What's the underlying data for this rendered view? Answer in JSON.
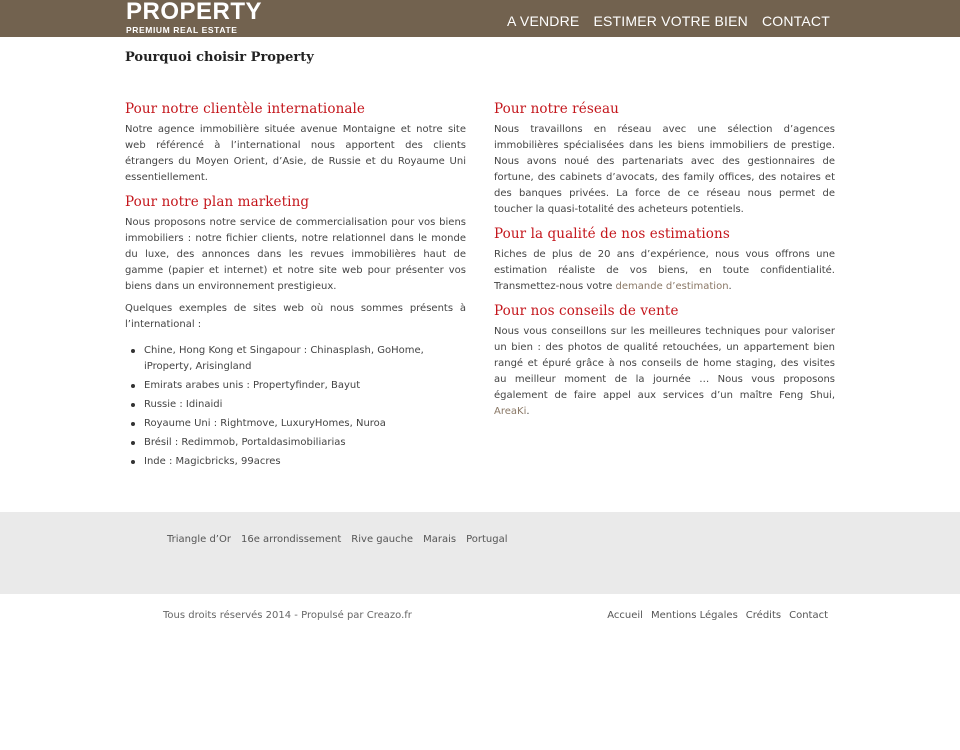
{
  "header": {
    "logo_title": "PROPERTY",
    "logo_subtitle": "PREMIUM REAL ESTATE",
    "nav": [
      "A VENDRE",
      "ESTIMER VOTRE BIEN",
      "CONTACT"
    ],
    "bg_color": "#72624f"
  },
  "page": {
    "title": "Pourquoi choisir Property"
  },
  "left": {
    "international": {
      "heading": "Pour notre clientèle internationale",
      "text": "Notre agence immobilière située avenue Montaigne et notre site web référencé à l’international nous apportent des clients étrangers du Moyen Orient, d’Asie, de Russie et du Royaume Uni essentiellement."
    },
    "marketing": {
      "heading": "Pour notre plan marketing",
      "text1": "Nous proposons notre service de commercialisation pour vos biens immobiliers : notre fichier clients, notre relationnel dans le monde du luxe, des annonces dans les revues immobilières haut de gamme (papier et internet) et notre site web pour présenter vos biens dans un environnement prestigieux.",
      "text2": "Quelques exemples de sites web où nous sommes présents à l’international :",
      "examples": [
        "Chine, Hong Kong et Singapour : Chinasplash, GoHome, iProperty, Arisingland",
        "Emirats arabes unis : Propertyfinder, Bayut",
        "Russie : Idinaidi",
        "Royaume Uni : Rightmove, LuxuryHomes, Nuroa",
        "Brésil : Redimmob, Portaldasimobiliarias",
        "Inde : Magicbricks, 99acres"
      ]
    }
  },
  "right": {
    "reseau": {
      "heading": "Pour notre réseau",
      "text": "Nous travaillons en réseau avec une sélection d’agences immobilières spécialisées dans les biens immobiliers de prestige. Nous avons noué des partenariats avec des gestionnaires de fortune, des cabinets d’avocats, des family offices, des notaires et des banques privées. La force de ce réseau nous permet de toucher la quasi-totalité des acheteurs potentiels."
    },
    "estimations": {
      "heading": "Pour la qualité de nos estimations",
      "text": "Riches de plus de 20 ans d’expérience, nous vous offrons une estimation réaliste de vos biens, en toute confidentialité. Transmettez-nous votre ",
      "link": "demande d’estimation",
      "end": "."
    },
    "conseils": {
      "heading": "Pour nos conseils de vente",
      "text": "Nous vous conseillons sur les meilleures techniques pour valoriser un bien : des photos de qualité retouchées, un appartement bien rangé et épuré grâce à nos conseils de home staging, des visites au meilleur moment de la journée … Nous vous proposons également de faire appel aux services d’un maître Feng Shui, ",
      "link": "AreaKi",
      "end": "."
    },
    "heading_color": "#c4161c"
  },
  "footer": {
    "links": [
      "Triangle d’Or",
      "16e arrondissement",
      "Rive gauche",
      "Marais",
      "Portugal"
    ],
    "copyright": "Tous droits réservés 2014 - Propulsé par Creazo.fr",
    "bottom_links": [
      "Accueil",
      "Mentions Légales",
      "Crédits",
      "Contact"
    ]
  }
}
